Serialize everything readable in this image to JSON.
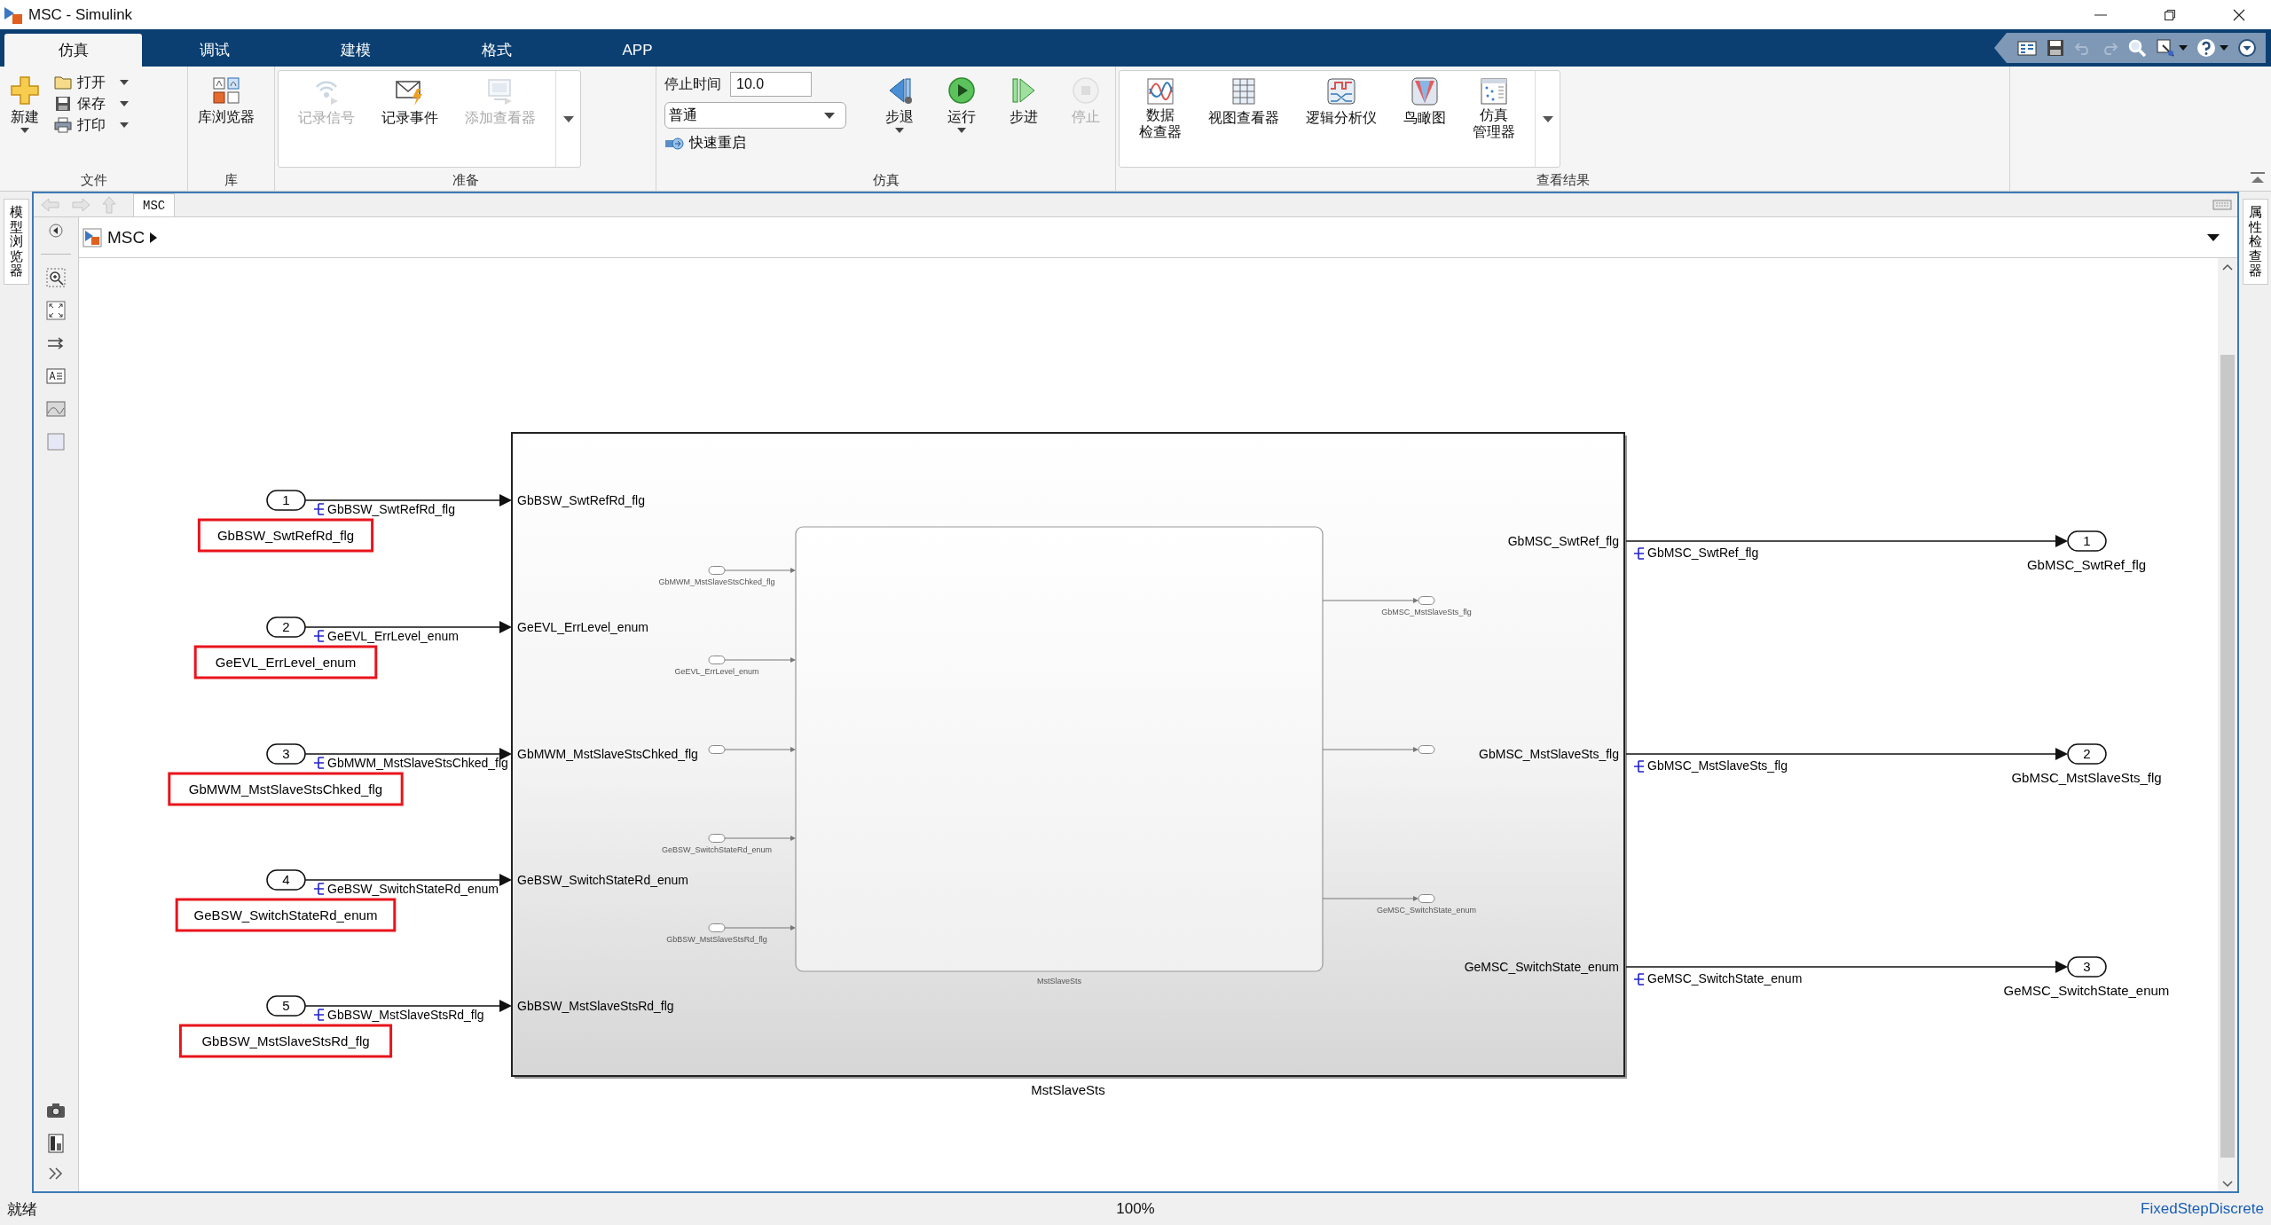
{
  "window": {
    "title": "MSC - Simulink"
  },
  "ribbon_tabs": [
    {
      "label": "仿真",
      "selected": true
    },
    {
      "label": "调试",
      "selected": false
    },
    {
      "label": "建模",
      "selected": false
    },
    {
      "label": "格式",
      "selected": false
    },
    {
      "label": "APP",
      "selected": false
    }
  ],
  "ribbon": {
    "sections": [
      {
        "kind": "file",
        "title": "文件",
        "items": [
          {
            "label": "新建",
            "menu": true,
            "disabled": false
          },
          {
            "label": "打开",
            "menu": true,
            "disabled": false
          },
          {
            "label": "保存",
            "menu": true,
            "disabled": false
          },
          {
            "label": "打印",
            "menu": true,
            "disabled": false
          }
        ]
      },
      {
        "kind": "single",
        "title": "库",
        "items": [
          {
            "label": "库浏览器",
            "menu": false,
            "disabled": false
          }
        ]
      },
      {
        "kind": "gallery",
        "title": "准备",
        "items": [
          {
            "label": "记录信号",
            "menu": false,
            "disabled": true
          },
          {
            "label": "记录事件",
            "menu": false,
            "disabled": false
          },
          {
            "label": "添加查看器",
            "menu": false,
            "disabled": true
          }
        ]
      },
      {
        "kind": "simulation",
        "title": "仿真",
        "stop_time_label": "停止时间",
        "stop_time": "10.0",
        "mode": "普通",
        "fast_restart": "快速重启",
        "items": [
          {
            "label": "步退",
            "menu": true,
            "disabled": false
          },
          {
            "label": "运行",
            "menu": true,
            "disabled": false
          },
          {
            "label": "步进",
            "menu": false,
            "disabled": false
          },
          {
            "label": "停止",
            "menu": false,
            "disabled": true
          }
        ]
      },
      {
        "kind": "gallery",
        "title": "查看结果",
        "items": [
          {
            "lines": [
              "数据",
              "检查器"
            ],
            "menu": false,
            "disabled": false
          },
          {
            "label": "视图查看器",
            "menu": false,
            "disabled": false
          },
          {
            "label": "逻辑分析仪",
            "menu": false,
            "disabled": false
          },
          {
            "label": "鸟瞰图",
            "menu": false,
            "disabled": false
          },
          {
            "lines": [
              "仿真",
              "管理器"
            ],
            "menu": false,
            "disabled": false
          }
        ]
      }
    ]
  },
  "editor": {
    "left_panel_tab": "模型浏览器",
    "right_panel_tab": "属性检查器",
    "breadcrumb_tab": "MSC",
    "address": "MSC"
  },
  "diagram": {
    "inports": [
      {
        "number": "1",
        "name": "GbBSW_SwtRefRd_flg",
        "signal": "GbBSW_SwtRefRd_flg",
        "port_label": "GbBSW_SwtRefRd_flg",
        "highlighted": true
      },
      {
        "number": "2",
        "name": "GeEVL_ErrLevel_enum",
        "signal": "GeEVL_ErrLevel_enum",
        "port_label": "GeEVL_ErrLevel_enum",
        "highlighted": true
      },
      {
        "number": "3",
        "name": "GbMWM_MstSlaveStsChked_flg",
        "signal": "GbMWM_MstSlaveStsChked_flg",
        "port_label": "GbMWM_MstSlaveStsChked_flg",
        "highlighted": true
      },
      {
        "number": "4",
        "name": "GeBSW_SwitchStateRd_enum",
        "signal": "GeBSW_SwitchStateRd_enum",
        "port_label": "GeBSW_SwitchStateRd_enum",
        "highlighted": true
      },
      {
        "number": "5",
        "name": "GbBSW_MstSlaveStsRd_flg",
        "signal": "GbBSW_MstSlaveStsRd_flg",
        "port_label": "GbBSW_MstSlaveStsRd_flg",
        "highlighted": true
      }
    ],
    "subsystem": {
      "name": "MstSlaveSts"
    },
    "inner_block": {
      "name": "MstSlaveSts",
      "inputs": [
        {
          "kind": "labeled",
          "label": "GbMWM_MstSlaveStsChked_flg"
        },
        {
          "kind": "labeled",
          "label": "GeEVL_ErrLevel_enum"
        },
        {
          "kind": "plain"
        },
        {
          "kind": "labeled",
          "label": "GeBSW_SwitchStateRd_enum"
        },
        {
          "kind": "labeled",
          "label": "GbBSW_MstSlaveStsRd_flg"
        }
      ],
      "outputs": [
        {
          "kind": "labeled",
          "label": "GbMSC_MstSlaveSts_flg"
        },
        {
          "kind": "plain"
        },
        {
          "kind": "labeled",
          "label": "GeMSC_SwitchState_enum"
        }
      ]
    },
    "outports": [
      {
        "number": "1",
        "name": "GbMSC_SwtRef_flg",
        "signal": "GbMSC_SwtRef_flg",
        "port_label": "GbMSC_SwtRef_flg"
      },
      {
        "number": "2",
        "name": "GbMSC_MstSlaveSts_flg",
        "signal": "GbMSC_MstSlaveSts_flg",
        "port_label": "GbMSC_MstSlaveSts_flg"
      },
      {
        "number": "3",
        "name": "GeMSC_SwitchState_enum",
        "signal": "GeMSC_SwitchState_enum",
        "port_label": "GeMSC_SwitchState_enum"
      }
    ]
  },
  "status_bar": {
    "state": "就绪",
    "zoom": "100%",
    "solver": "FixedStepDiscrete"
  }
}
